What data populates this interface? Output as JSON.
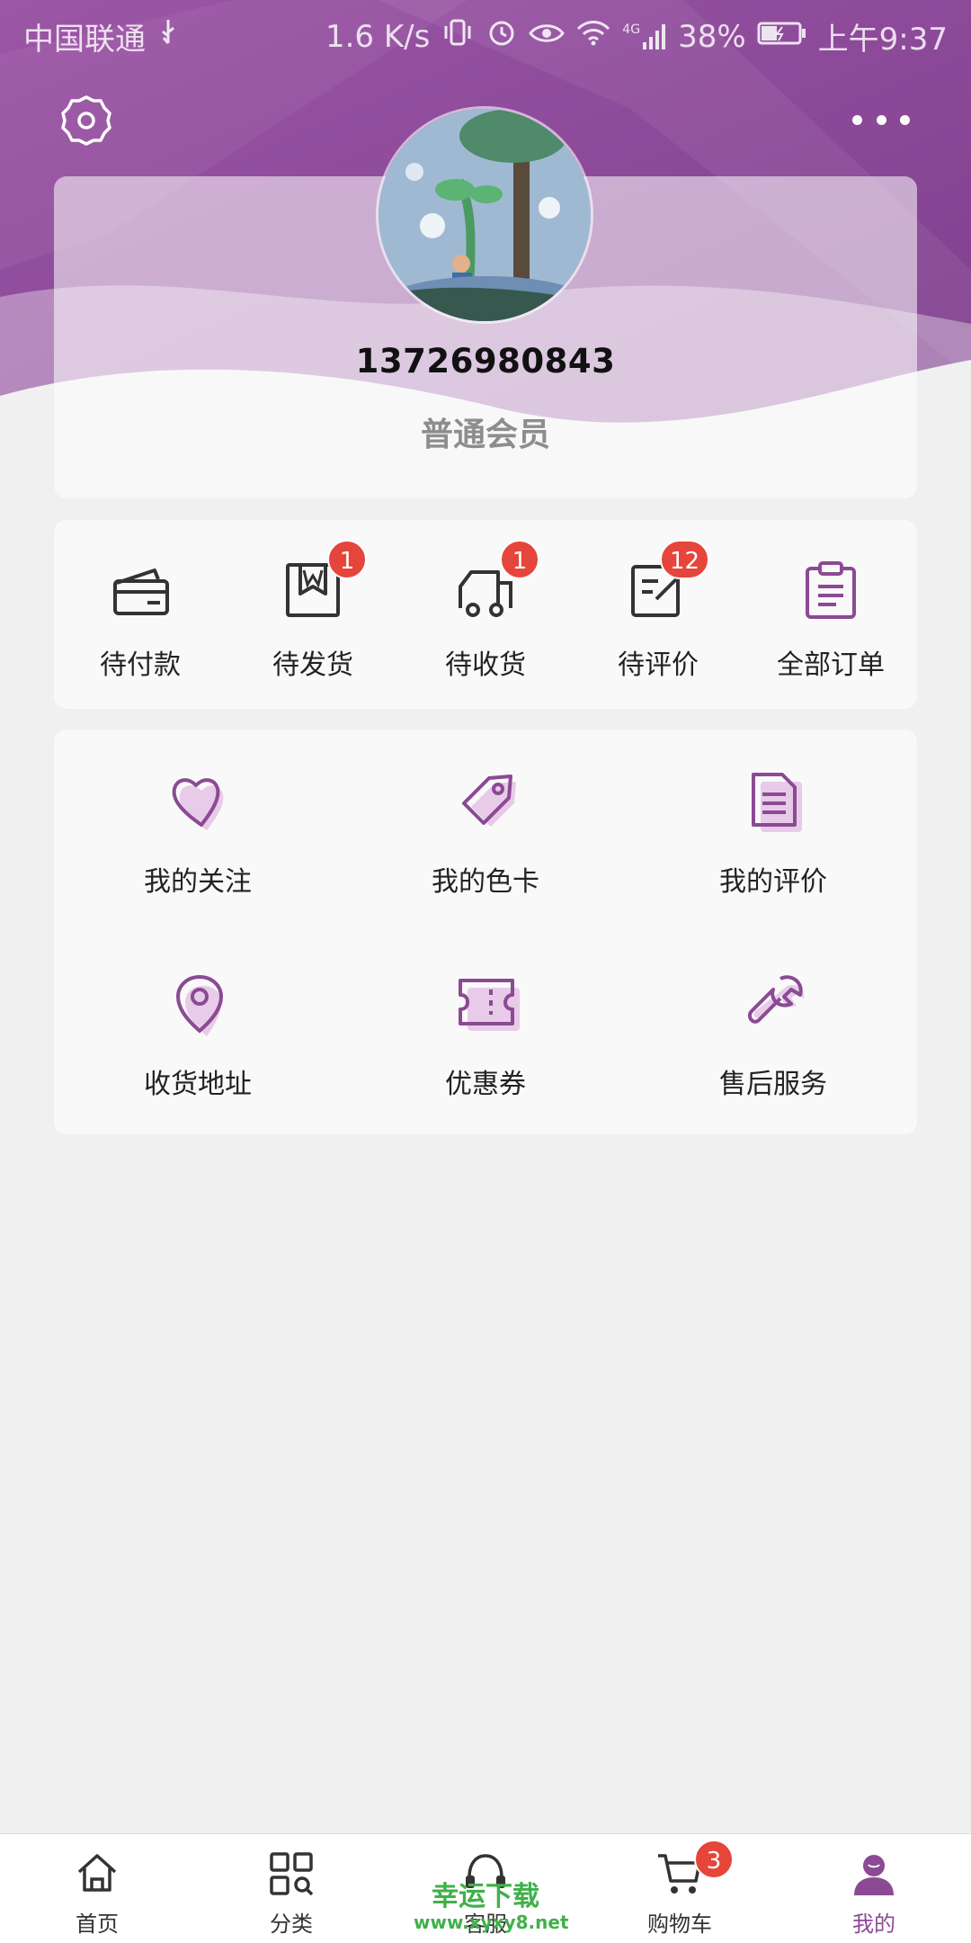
{
  "colors": {
    "accent": "#8b4a93",
    "header": "#9a56a4",
    "badge": "#e5453b",
    "background": "#f0f0f0"
  },
  "status_bar": {
    "carrier": "中国联通",
    "speed": "1.6 K/s",
    "network": "4G",
    "battery": "38%",
    "time": "上午9:37"
  },
  "profile": {
    "phone": "13726980843",
    "level": "普通会员"
  },
  "orders": [
    {
      "label": "待付款",
      "icon": "wallet-icon",
      "badge": ""
    },
    {
      "label": "待发货",
      "icon": "package-icon",
      "badge": "1"
    },
    {
      "label": "待收货",
      "icon": "truck-icon",
      "badge": "1"
    },
    {
      "label": "待评价",
      "icon": "edit-note-icon",
      "badge": "12"
    },
    {
      "label": "全部订单",
      "icon": "clipboard-icon",
      "badge": ""
    }
  ],
  "services": [
    {
      "label": "我的关注",
      "icon": "heart-icon"
    },
    {
      "label": "我的色卡",
      "icon": "tag-icon"
    },
    {
      "label": "我的评价",
      "icon": "document-icon"
    },
    {
      "label": "收货地址",
      "icon": "location-pin-icon"
    },
    {
      "label": "优惠券",
      "icon": "coupon-icon"
    },
    {
      "label": "售后服务",
      "icon": "wrench-icon"
    }
  ],
  "tabs": [
    {
      "label": "首页",
      "icon": "home-icon",
      "badge": ""
    },
    {
      "label": "分类",
      "icon": "category-icon",
      "badge": ""
    },
    {
      "label": "客服",
      "icon": "headset-icon",
      "badge": ""
    },
    {
      "label": "购物车",
      "icon": "cart-icon",
      "badge": "3"
    },
    {
      "label": "我的",
      "icon": "user-icon",
      "badge": ""
    }
  ],
  "watermark": {
    "title": "幸运下载",
    "url": "www.xyxy8.net"
  }
}
